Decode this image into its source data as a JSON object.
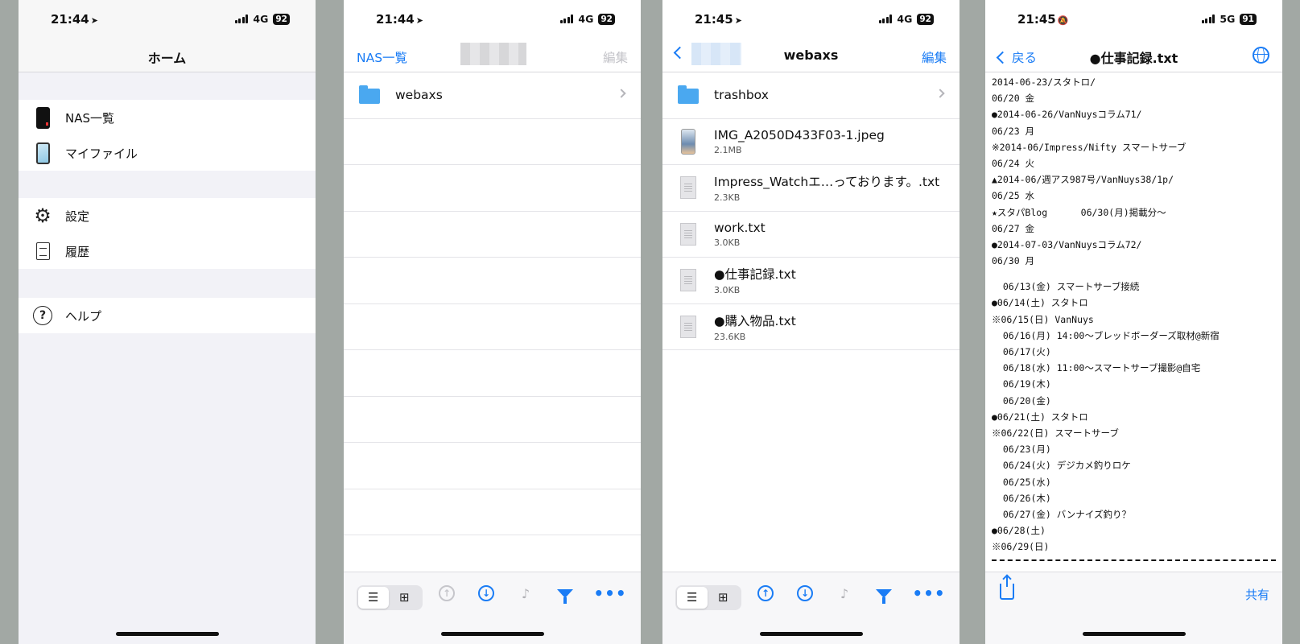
{
  "colors": {
    "accent": "#1a7cf5",
    "background": "#a2a8a4"
  },
  "screen1": {
    "status": {
      "time": "21:44",
      "network": "4G",
      "battery": "92"
    },
    "title": "ホーム",
    "menu": [
      {
        "label": "NAS一覧",
        "icon": "phone-dark-icon"
      },
      {
        "label": "マイファイル",
        "icon": "phone-light-icon"
      },
      {
        "label": "設定",
        "icon": "gear-icon"
      },
      {
        "label": "履歴",
        "icon": "document-icon"
      },
      {
        "label": "ヘルプ",
        "icon": "help-icon"
      }
    ]
  },
  "screen2": {
    "status": {
      "time": "21:44",
      "network": "4G",
      "battery": "92"
    },
    "back_label": "NAS一覧",
    "edit_label": "編集",
    "items": [
      {
        "name": "webaxs",
        "type": "folder"
      }
    ]
  },
  "screen3": {
    "status": {
      "time": "21:45",
      "network": "4G",
      "battery": "92"
    },
    "title": "webaxs",
    "edit_label": "編集",
    "items": [
      {
        "name": "trashbox",
        "type": "folder",
        "size": ""
      },
      {
        "name": "IMG_A2050D433F03-1.jpeg",
        "type": "image",
        "size": "2.1MB"
      },
      {
        "name": "Impress_Watchエ…っております。.txt",
        "type": "text",
        "size": "2.3KB"
      },
      {
        "name": "work.txt",
        "type": "text",
        "size": "3.0KB"
      },
      {
        "name": "●仕事記録.txt",
        "type": "text",
        "size": "3.0KB"
      },
      {
        "name": "●購入物品.txt",
        "type": "text",
        "size": "23.6KB"
      }
    ]
  },
  "screen4": {
    "status": {
      "time": "21:45",
      "network": "5G",
      "battery": "91"
    },
    "back_label": "戻る",
    "title": "●仕事記録.txt",
    "share_label": "共有",
    "lines_a": [
      "2014-06-23/スタトロ/",
      "06/20 金",
      "●2014-06-26/VanNuysコラム71/",
      "06/23 月",
      "※2014-06/Impress/Nifty スマートサーブ",
      "06/24 火",
      "▲2014-06/週アス987号/VanNuys38/1p/",
      "06/25 水",
      "★スタパBlog      06/30(月)掲載分〜",
      "06/27 金",
      "●2014-07-03/VanNuysコラム72/",
      "06/30 月"
    ],
    "lines_b": [
      "  06/13(金) スマートサーブ接続",
      "●06/14(土) スタトロ",
      "※06/15(日) VanNuys",
      "  06/16(月) 14:00〜ブレッドボーダーズ取材@新宿",
      "  06/17(火)",
      "  06/18(水) 11:00〜スマートサーブ撮影@自宅",
      "  06/19(木)",
      "  06/20(金)",
      "●06/21(土) スタトロ",
      "※06/22(日) スマートサーブ",
      "  06/23(月)",
      "  06/24(火) デジカメ釣りロケ",
      "  06/25(水)",
      "  06/26(木)",
      "  06/27(金) バンナイズ釣り？",
      "●06/28(土)",
      "※06/29(日)"
    ]
  }
}
